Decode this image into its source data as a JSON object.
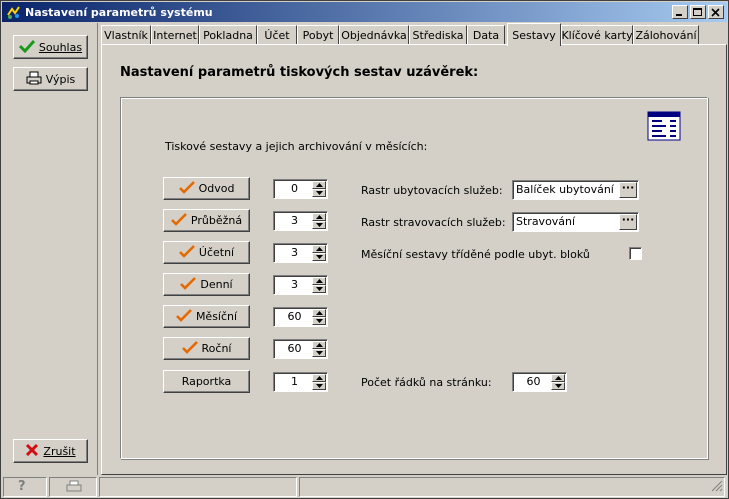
{
  "window": {
    "title": "Nastavení parametrů systému",
    "accent": "#0a246a"
  },
  "sidebar": {
    "ok_label": "Souhlas",
    "print_label": "Výpis",
    "cancel_label": "Zrušit"
  },
  "tabs": [
    {
      "label": "Vlastník"
    },
    {
      "label": "Internet"
    },
    {
      "label": "Pokladna"
    },
    {
      "label": "Účet"
    },
    {
      "label": "Pobyt"
    },
    {
      "label": "Objednávka"
    },
    {
      "label": "Střediska"
    },
    {
      "label": "Data"
    },
    {
      "label": "Sestavy",
      "active": true
    },
    {
      "label": "Klíčové karty"
    },
    {
      "label": "Zálohování"
    }
  ],
  "panel": {
    "title": "Nastavení parametrů tiskových sestav uzávěrek:",
    "subtitle": "Tiskové sestavy a jejich archivování v měsících:",
    "reports": [
      {
        "label": "Odvod",
        "value": "0",
        "checked": true
      },
      {
        "label": "Průběžná",
        "value": "3",
        "checked": true
      },
      {
        "label": "Účetní",
        "value": "3",
        "checked": true
      },
      {
        "label": "Denní",
        "value": "3",
        "checked": true
      },
      {
        "label": "Měsíční",
        "value": "60",
        "checked": true
      },
      {
        "label": "Roční",
        "value": "60",
        "checked": true
      },
      {
        "label": "Raportka",
        "value": "1",
        "checked": false
      }
    ],
    "accommodation_label": "Rastr ubytovacích služeb:",
    "accommodation_value": "Balíček ubytování",
    "catering_label": "Rastr stravovacích služeb:",
    "catering_value": "Stravování",
    "monthly_sorted_label": "Měsíční sestavy tříděné podle ubyt. bloků",
    "monthly_sorted_checked": false,
    "rows_label": "Počet řádků na stránku:",
    "rows_value": "60"
  }
}
